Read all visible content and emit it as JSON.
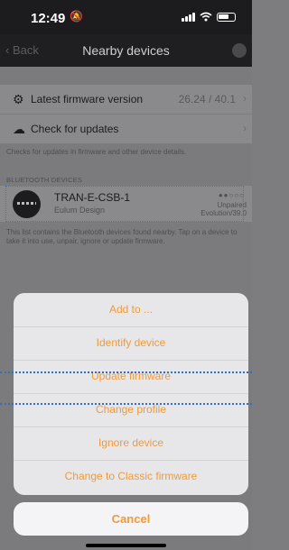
{
  "status_bar": {
    "time": "12:49"
  },
  "nav": {
    "back": "Back",
    "title": "Nearby devices"
  },
  "rows": [
    {
      "label": "Latest firmware version",
      "value": "26.24 / 40.1"
    },
    {
      "label": "Check for updates",
      "value": ""
    }
  ],
  "rows_note": "Checks for updates in firmware and other device details.",
  "section_header": "BLUETOOTH DEVICES",
  "device": {
    "name": "TRAN-E-CSB-1",
    "maker": "Eulum Design",
    "status": "Unpaired",
    "profile": "Evolution/39.0",
    "signal": "●●○○○"
  },
  "device_note": "This list contains the Bluetooth devices found nearby. Tap on a device to take it into use, unpair, ignore or update firmware.",
  "action_sheet": {
    "items": [
      "Add to ...",
      "Identify device",
      "Update firmware",
      "Change profile",
      "Ignore device",
      "Change to Classic firmware"
    ],
    "cancel": "Cancel",
    "accent_color": "#f09a3a"
  }
}
